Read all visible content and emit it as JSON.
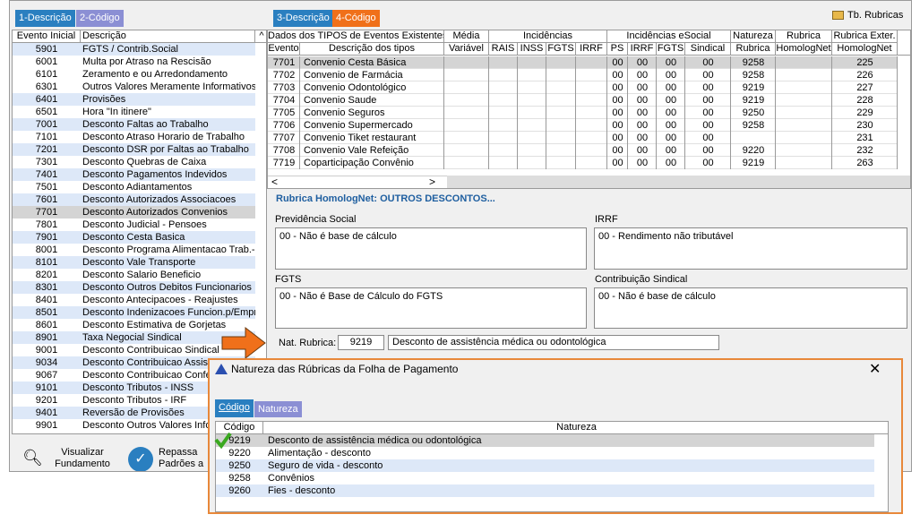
{
  "left_tabs": [
    "1-Descrição",
    "2-Código"
  ],
  "right_tabs": [
    "3-Descrição",
    "4-Código"
  ],
  "toolbar": {
    "tb_rubricas_label": "Tb. Rubricas"
  },
  "events_list": {
    "headers": [
      "Evento Inicial",
      "Descrição"
    ],
    "rows": [
      {
        "code": "5901",
        "desc": "FGTS / Contrib.Social"
      },
      {
        "code": "6001",
        "desc": "Multa por Atraso na Rescisão"
      },
      {
        "code": "6101",
        "desc": "Zeramento e ou Arredondamento"
      },
      {
        "code": "6301",
        "desc": "Outros Valores Meramente Informativos"
      },
      {
        "code": "6401",
        "desc": "Provisões"
      },
      {
        "code": "6501",
        "desc": "Hora \"In itinere\""
      },
      {
        "code": "7001",
        "desc": "Desconto Faltas ao Trabalho"
      },
      {
        "code": "7101",
        "desc": "Desconto Atraso Horario de Trabalho"
      },
      {
        "code": "7201",
        "desc": "Desconto DSR por Faltas ao Trabalho"
      },
      {
        "code": "7301",
        "desc": "Desconto Quebras de Caixa"
      },
      {
        "code": "7401",
        "desc": "Desconto Pagamentos Indevidos"
      },
      {
        "code": "7501",
        "desc": "Desconto Adiantamentos"
      },
      {
        "code": "7601",
        "desc": "Desconto Autorizados Associacoes"
      },
      {
        "code": "7701",
        "desc": "Desconto Autorizados Convenios"
      },
      {
        "code": "7801",
        "desc": "Desconto Judicial - Pensoes"
      },
      {
        "code": "7901",
        "desc": "Desconto Cesta Basica"
      },
      {
        "code": "8001",
        "desc": "Desconto Programa Alimentacao Trab.-PAT"
      },
      {
        "code": "8101",
        "desc": "Desconto Vale Transporte"
      },
      {
        "code": "8201",
        "desc": "Desconto Salario Beneficio"
      },
      {
        "code": "8301",
        "desc": "Desconto Outros Debitos Funcionarios"
      },
      {
        "code": "8401",
        "desc": "Desconto Antecipacoes - Reajustes"
      },
      {
        "code": "8501",
        "desc": "Desconto Indenizacoes Funcion.p/Empresa"
      },
      {
        "code": "8601",
        "desc": "Desconto Estimativa de Gorjetas"
      },
      {
        "code": "8901",
        "desc": "Taxa Negocial Sindical"
      },
      {
        "code": "9001",
        "desc": "Desconto Contribuicao Sindical"
      },
      {
        "code": "9034",
        "desc": "Desconto Contribuicao Assistencial"
      },
      {
        "code": "9067",
        "desc": "Desconto Contribuicao Confederativa"
      },
      {
        "code": "9101",
        "desc": "Desconto Tributos - INSS"
      },
      {
        "code": "9201",
        "desc": "Desconto Tributos - IRF"
      },
      {
        "code": "9401",
        "desc": "Reversão de Provisões"
      },
      {
        "code": "9901",
        "desc": "Desconto Outros Valores Informativos"
      }
    ]
  },
  "bottom_buttons": {
    "visualizar": "Visualizar Fundamento",
    "repassa": "Repassa Padrões a"
  },
  "types_table": {
    "group_headers": [
      "Dados dos TIPOS de Eventos Existentes",
      "Média",
      "Incidências",
      "Incidências eSocial",
      "Natureza",
      "Rubrica",
      "Rubrica Exter."
    ],
    "sub_headers": [
      "Evento",
      "Descrição dos tipos",
      "Variável",
      "RAIS",
      "INSS",
      "FGTS",
      "IRRF",
      "PS",
      "IRRF",
      "FGTS",
      "Sindical",
      "Rubrica",
      "HomologNet",
      "HomologNet"
    ],
    "rows": [
      {
        "evento": "7701",
        "desc": "Convenio Cesta Básica",
        "ps": "00",
        "irrf": "00",
        "fgts": "00",
        "sind": "00",
        "nat": "9258",
        "ext": "225"
      },
      {
        "evento": "7702",
        "desc": "Convenio de Farmácia",
        "ps": "00",
        "irrf": "00",
        "fgts": "00",
        "sind": "00",
        "nat": "9258",
        "ext": "226"
      },
      {
        "evento": "7703",
        "desc": "Convenio Odontológico",
        "ps": "00",
        "irrf": "00",
        "fgts": "00",
        "sind": "00",
        "nat": "9219",
        "ext": "227"
      },
      {
        "evento": "7704",
        "desc": "Convenio Saude",
        "ps": "00",
        "irrf": "00",
        "fgts": "00",
        "sind": "00",
        "nat": "9219",
        "ext": "228"
      },
      {
        "evento": "7705",
        "desc": "Convenio Seguros",
        "ps": "00",
        "irrf": "00",
        "fgts": "00",
        "sind": "00",
        "nat": "9250",
        "ext": "229"
      },
      {
        "evento": "7706",
        "desc": "Convenio Supermercado",
        "ps": "00",
        "irrf": "00",
        "fgts": "00",
        "sind": "00",
        "nat": "9258",
        "ext": "230"
      },
      {
        "evento": "7707",
        "desc": "Convenio Tiket restaurant",
        "ps": "00",
        "irrf": "00",
        "fgts": "00",
        "sind": "00",
        "nat": "",
        "ext": "231"
      },
      {
        "evento": "7708",
        "desc": "Convenio Vale Refeição",
        "ps": "00",
        "irrf": "00",
        "fgts": "00",
        "sind": "00",
        "nat": "9220",
        "ext": "232"
      },
      {
        "evento": "7719",
        "desc": "Coparticipação Convênio",
        "ps": "00",
        "irrf": "00",
        "fgts": "00",
        "sind": "00",
        "nat": "9219",
        "ext": "263"
      }
    ]
  },
  "rubrica_title": "Rubrica HomologNet: OUTROS DESCONTOS...",
  "fields": {
    "prev_label": "Previdência Social",
    "prev_value": "00 - Não é base de cálculo",
    "irrf_label": "IRRF",
    "irrf_value": "00 - Rendimento não tributável",
    "fgts_label": "FGTS",
    "fgts_value": "00 - Não é Base de Cálculo do FGTS",
    "sind_label": "Contribuição Sindical",
    "sind_value": "00 - Não é base de cálculo"
  },
  "nat_rubrica": {
    "label": "Nat. Rubrica:",
    "code": "9219",
    "desc": "Desconto de assistência médica ou odontológica"
  },
  "dialog": {
    "title": "Natureza das Rúbricas da Folha de Pagamento",
    "tabs": [
      "Código",
      "Natureza"
    ],
    "headers": [
      "Código",
      "Natureza"
    ],
    "rows": [
      {
        "code": "9219",
        "nat": "Desconto de assistência médica ou odontológica"
      },
      {
        "code": "9220",
        "nat": "Alimentação - desconto"
      },
      {
        "code": "9250",
        "nat": "Seguro de vida - desconto"
      },
      {
        "code": "9258",
        "nat": "Convênios"
      },
      {
        "code": "9260",
        "nat": "Fies - desconto"
      }
    ]
  },
  "colors": {
    "accent_orange": "#f0701a",
    "tab_blue": "#2a7fc0",
    "tab_lavender": "#8b8fd4",
    "row_blue": "#dde8f8"
  }
}
